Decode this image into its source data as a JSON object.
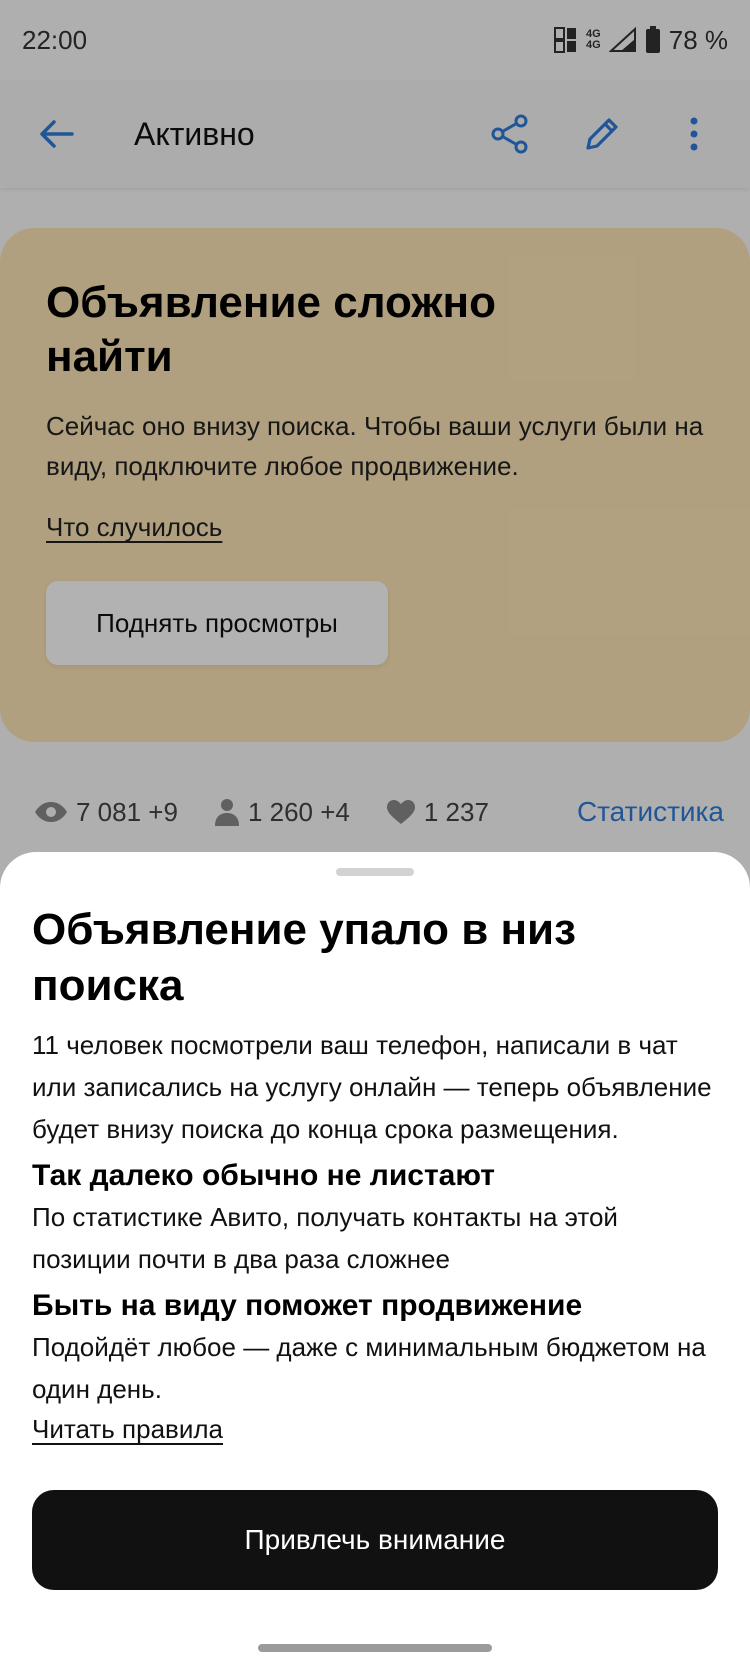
{
  "status_bar": {
    "time": "22:00",
    "network_top": "4G",
    "network_bottom": "4G",
    "battery": "78 %"
  },
  "app_bar": {
    "title": "Активно",
    "icons": [
      "back-arrow-icon",
      "share-icon",
      "edit-pencil-icon",
      "more-vertical-icon"
    ],
    "accent_color": "#2f7bd8"
  },
  "promo_card": {
    "title": "Объявление сложно найти",
    "text": "Сейчас оно внизу поиска. Чтобы ваши услуги были на виду, подключите любое продвижение.",
    "link": "Что случилось",
    "button": "Поднять просмотры",
    "background_color": "#fde6b7"
  },
  "stats": {
    "views": "7 081 +9",
    "contacts": "1 260 +4",
    "favorites": "1 237",
    "link": "Статистика"
  },
  "sheet": {
    "title": "Объявление упало в низ поиска",
    "text_1": "11 человек посмотрели ваш телефон, написали в чат или записались на услугу онлайн — теперь объявление будет внизу поиска до конца срока размещения.",
    "subtitle_2": "Так далеко обычно не листают",
    "text_2": "По статистике Авито, получать контакты на этой позиции почти в два раза сложнее",
    "subtitle_3": "Быть на виду поможет продвижение",
    "text_3": "Подойдёт любое — даже с минимальным бюджетом на один день.",
    "link": "Читать правила",
    "cta": "Привлечь внимание"
  }
}
